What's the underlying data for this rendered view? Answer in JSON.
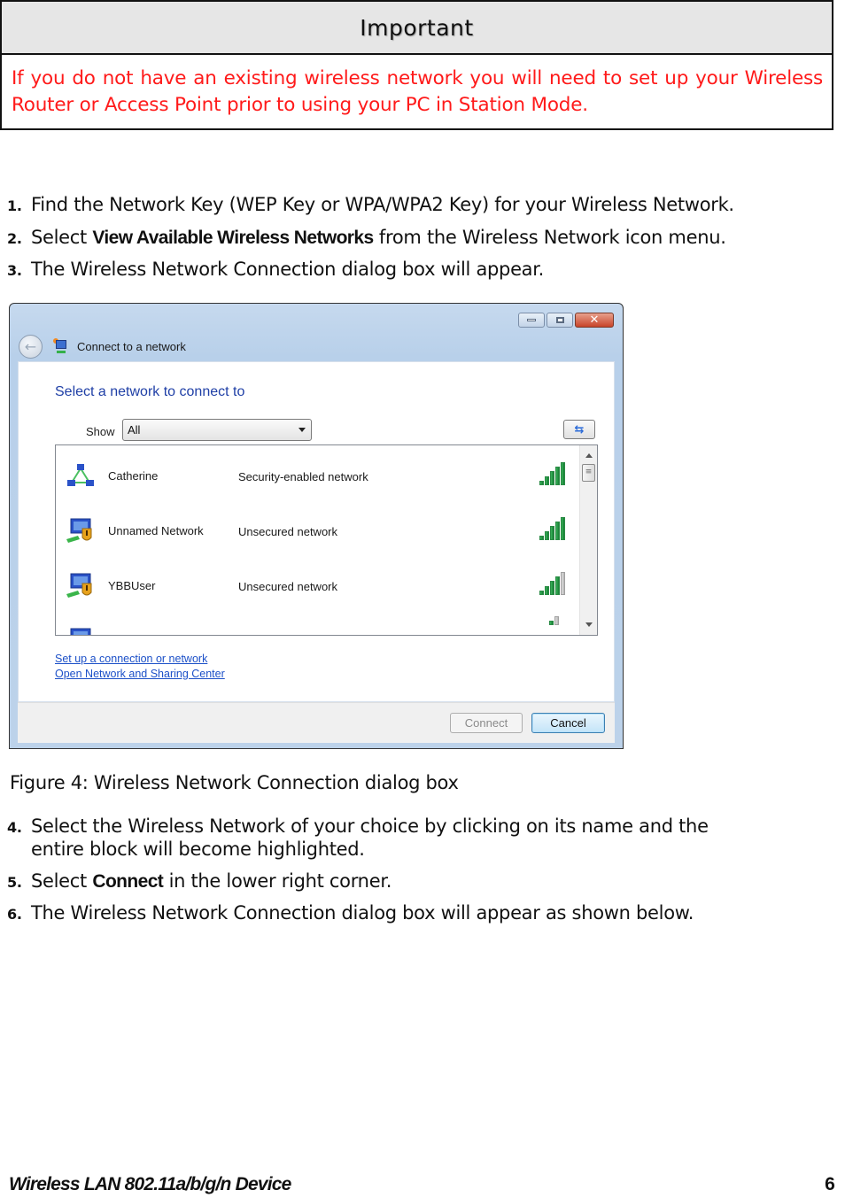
{
  "important": {
    "title": "Important",
    "body": "If you do not have an existing wireless network you will need to set up your Wireless Router or Access Point prior to using your PC in Station Mode.",
    "body_color": "#ff1a1a"
  },
  "steps_before": [
    {
      "num": "1.",
      "pre": "Find the Network Key (WEP Key or WPA/WPA2 Key) for your Wireless Network.",
      "bold": "",
      "post": ""
    },
    {
      "num": "2.",
      "pre": "Select ",
      "bold": "View Available Wireless Networks",
      "post": " from the Wireless Network icon menu."
    },
    {
      "num": "3.",
      "pre": "The Wireless Network Connection dialog box will appear.",
      "bold": "",
      "post": ""
    }
  ],
  "dialog": {
    "window_controls": {
      "minimize": "minimize-icon",
      "maximize": "maximize-icon",
      "close": "close-icon",
      "close_glyph": "✕"
    },
    "back_glyph": "←",
    "title": "Connect to a network",
    "heading": "Select a network to connect to",
    "show_label": "Show",
    "show_value": "All",
    "refresh_glyph": "⇆",
    "networks": [
      {
        "name": "Catherine",
        "security": "Security-enabled network",
        "signal_bars": 5,
        "signal_max": 5,
        "icon": "network-secured-icon"
      },
      {
        "name": "Unnamed Network",
        "security": "Unsecured network",
        "signal_bars": 5,
        "signal_max": 5,
        "icon": "network-unsecured-icon"
      },
      {
        "name": "YBBUser",
        "security": "Unsecured network",
        "signal_bars": 4,
        "signal_max": 5,
        "icon": "network-unsecured-icon"
      },
      {
        "name": "",
        "security": "",
        "signal_bars": 1,
        "signal_max": 2,
        "icon": "network-unsecured-icon"
      }
    ],
    "scroll_thumb_glyph": "≡",
    "links": [
      "Set up a connection or network",
      "Open Network and Sharing Center"
    ],
    "buttons": {
      "connect": "Connect",
      "cancel": "Cancel"
    }
  },
  "caption": "Figure 4: Wireless Network Connection dialog box",
  "steps_after": [
    {
      "num": "4.",
      "pre": "Select the Wireless Network of your choice by clicking on its name and the",
      "cont": "entire block will become highlighted.",
      "bold": "",
      "post": ""
    },
    {
      "num": "5.",
      "pre": "Select ",
      "bold": "Connect",
      "post": " in the lower right corner.",
      "cont": ""
    },
    {
      "num": "6.",
      "pre": "The Wireless Network Connection dialog box will appear as shown below.",
      "bold": "",
      "post": "",
      "cont": ""
    }
  ],
  "footer": {
    "title": "Wireless LAN 802.11a/b/g/n Device",
    "page": "6"
  }
}
